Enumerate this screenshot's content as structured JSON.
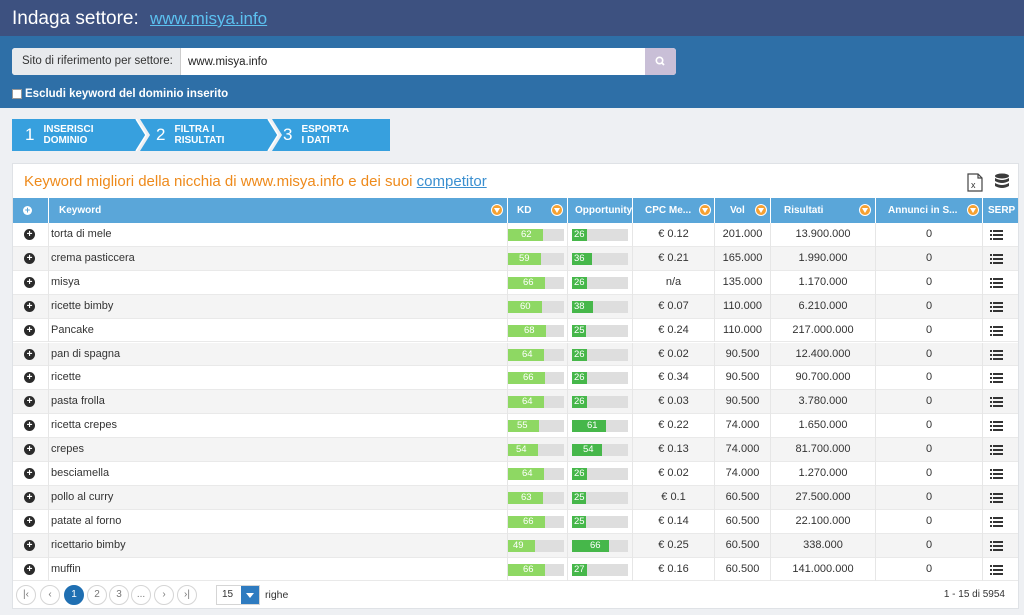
{
  "header": {
    "title": "Indaga settore:",
    "domain": "www.misya.info"
  },
  "search": {
    "label": "Sito di riferimento per settore:",
    "value": "www.misya.info",
    "button_icon": "search-icon"
  },
  "exclude_checkbox": {
    "label": "Escludi keyword del dominio inserito",
    "checked": false
  },
  "steps": [
    {
      "num": "1",
      "label": "INSERISCI DOMINIO"
    },
    {
      "num": "2",
      "label": "FILTRA I RISULTATI"
    },
    {
      "num": "3",
      "label": "ESPORTA I DATI"
    }
  ],
  "panel": {
    "title": "Keyword migliori della nicchia di www.misya.info e dei suoi ",
    "title_link": "competitor"
  },
  "columns": {
    "keyword": "Keyword",
    "kd": "KD",
    "opportunity": "Opportunity",
    "cpc": "CPC Me...",
    "vol": "Vol",
    "risultati": "Risultati",
    "annunci": "Annunci in S...",
    "serp": "SERP"
  },
  "colors": {
    "kd_bar": "#8ed863",
    "opp_bar": "#46b74a",
    "header_bg": "#5aa6d9",
    "accent": "#ee8a1b"
  },
  "rows": [
    {
      "keyword": "torta di mele",
      "kd": 62,
      "opp": 26,
      "cpc": "€ 0.12",
      "vol": "201.000",
      "ris": "13.900.000",
      "ann": "0"
    },
    {
      "keyword": "crema pasticcera",
      "kd": 59,
      "opp": 36,
      "cpc": "€ 0.21",
      "vol": "165.000",
      "ris": "1.990.000",
      "ann": "0"
    },
    {
      "keyword": "misya",
      "kd": 66,
      "opp": 26,
      "cpc": "n/a",
      "vol": "135.000",
      "ris": "1.170.000",
      "ann": "0"
    },
    {
      "keyword": "ricette bimby",
      "kd": 60,
      "opp": 38,
      "cpc": "€ 0.07",
      "vol": "110.000",
      "ris": "6.210.000",
      "ann": "0"
    },
    {
      "keyword": "Pancake",
      "kd": 68,
      "opp": 25,
      "cpc": "€ 0.24",
      "vol": "110.000",
      "ris": "217.000.000",
      "ann": "0"
    },
    {
      "keyword": "pan di spagna",
      "kd": 64,
      "opp": 26,
      "cpc": "€ 0.02",
      "vol": "90.500",
      "ris": "12.400.000",
      "ann": "0"
    },
    {
      "keyword": "ricette",
      "kd": 66,
      "opp": 26,
      "cpc": "€ 0.34",
      "vol": "90.500",
      "ris": "90.700.000",
      "ann": "0"
    },
    {
      "keyword": "pasta frolla",
      "kd": 64,
      "opp": 26,
      "cpc": "€ 0.03",
      "vol": "90.500",
      "ris": "3.780.000",
      "ann": "0"
    },
    {
      "keyword": "ricetta crepes",
      "kd": 55,
      "opp": 61,
      "cpc": "€ 0.22",
      "vol": "74.000",
      "ris": "1.650.000",
      "ann": "0"
    },
    {
      "keyword": "crepes",
      "kd": 54,
      "opp": 54,
      "cpc": "€ 0.13",
      "vol": "74.000",
      "ris": "81.700.000",
      "ann": "0"
    },
    {
      "keyword": "besciamella",
      "kd": 64,
      "opp": 26,
      "cpc": "€ 0.02",
      "vol": "74.000",
      "ris": "1.270.000",
      "ann": "0"
    },
    {
      "keyword": "pollo al curry",
      "kd": 63,
      "opp": 25,
      "cpc": "€ 0.1",
      "vol": "60.500",
      "ris": "27.500.000",
      "ann": "0"
    },
    {
      "keyword": "patate al forno",
      "kd": 66,
      "opp": 25,
      "cpc": "€ 0.14",
      "vol": "60.500",
      "ris": "22.100.000",
      "ann": "0"
    },
    {
      "keyword": "ricettario bimby",
      "kd": 49,
      "opp": 66,
      "cpc": "€ 0.25",
      "vol": "60.500",
      "ris": "338.000",
      "ann": "0"
    },
    {
      "keyword": "muffin",
      "kd": 66,
      "opp": 27,
      "cpc": "€ 0.16",
      "vol": "60.500",
      "ris": "141.000.000",
      "ann": "0"
    }
  ],
  "pagination": {
    "pages": [
      "1",
      "2",
      "3",
      "..."
    ],
    "current": "1",
    "per_page": "15",
    "rows_label": "righe",
    "summary": "1 - 15 di 5954"
  }
}
